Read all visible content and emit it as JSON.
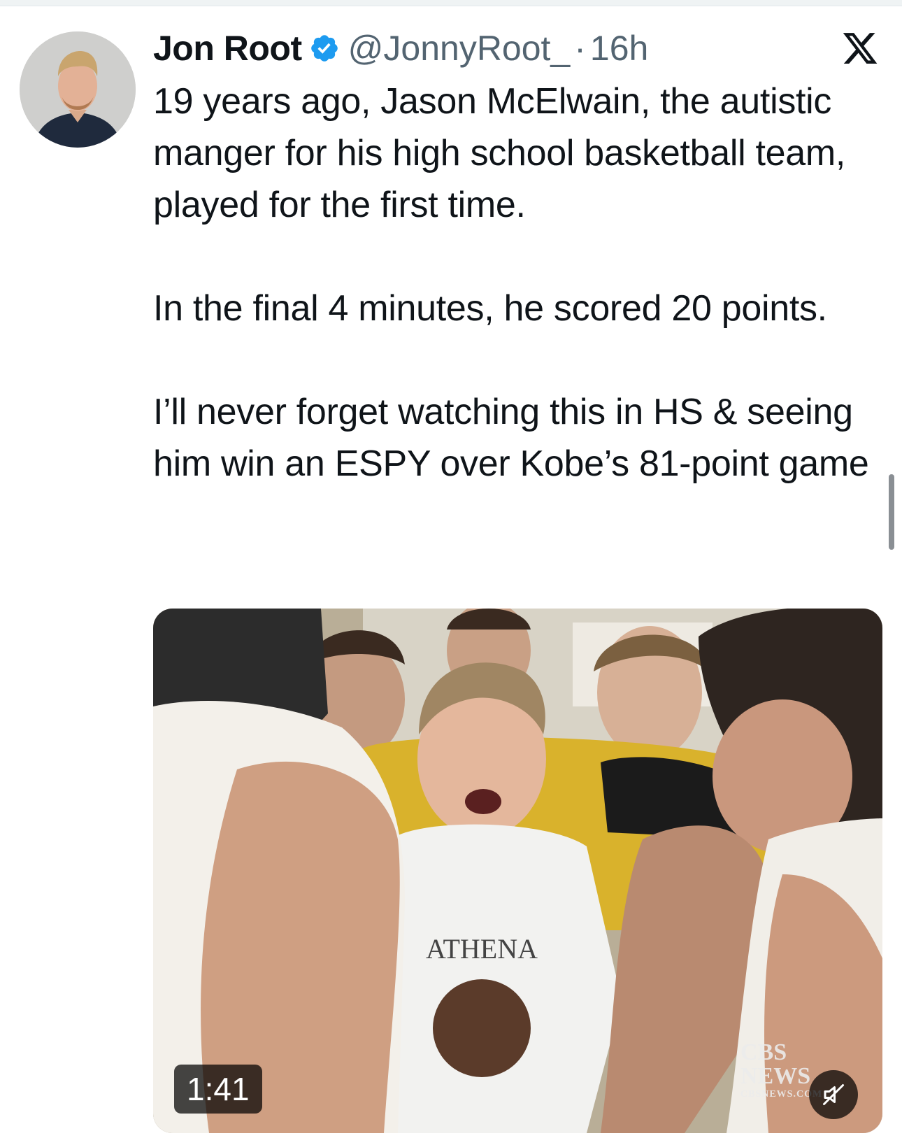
{
  "tweet": {
    "author": {
      "display_name": "Jon Root",
      "handle": "@JonnyRoot_",
      "separator": "·",
      "time": "16h",
      "verified": true,
      "avatar_icon": "profile-photo"
    },
    "text": {
      "paragraph1": "19 years ago, Jason McElwain, the autistic manger for his high school basketball team, played for the first time.",
      "paragraph2": "In the final 4 minutes, he scored 20 points.",
      "paragraph3": "I’ll never forget watching this in HS & seeing him win an ESPY over Kobe’s 81-point game"
    },
    "media": {
      "type": "video",
      "duration": "1:41",
      "muted": true,
      "watermark": {
        "line1": "CBS",
        "line2": "NEWS",
        "line3": "CBSNEWS.COM"
      }
    }
  },
  "app": {
    "logo_icon": "x-logo-icon"
  },
  "colors": {
    "text_primary": "#0f1419",
    "text_secondary": "#536471",
    "verified_blue": "#1d9bf0"
  }
}
